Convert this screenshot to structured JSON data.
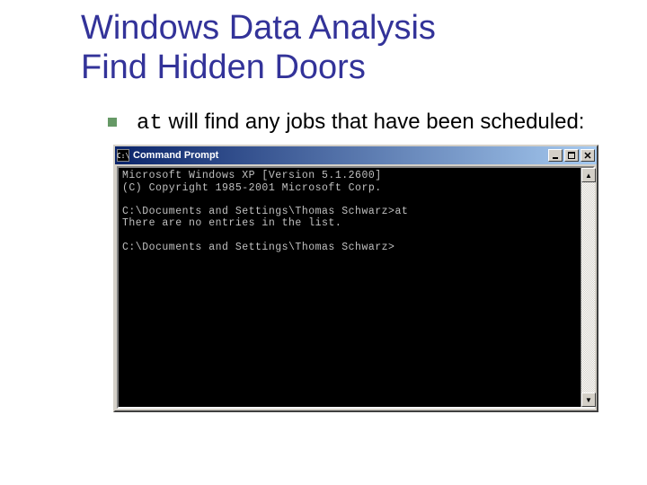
{
  "title_line1": "Windows Data Analysis",
  "title_line2": "Find Hidden Doors",
  "bullet": {
    "cmd": "at",
    "rest": "  will find any jobs that have been scheduled:"
  },
  "window": {
    "icon_text": "C:\\",
    "title": "Command Prompt",
    "buttons": {
      "minimize": "_",
      "maximize": "□",
      "close": "×"
    },
    "scroll": {
      "up": "▲",
      "down": "▼"
    }
  },
  "console": {
    "lines": [
      "Microsoft Windows XP [Version 5.1.2600]",
      "(C) Copyright 1985-2001 Microsoft Corp.",
      "",
      "C:\\Documents and Settings\\Thomas Schwarz>at",
      "There are no entries in the list.",
      "",
      "C:\\Documents and Settings\\Thomas Schwarz>"
    ]
  }
}
